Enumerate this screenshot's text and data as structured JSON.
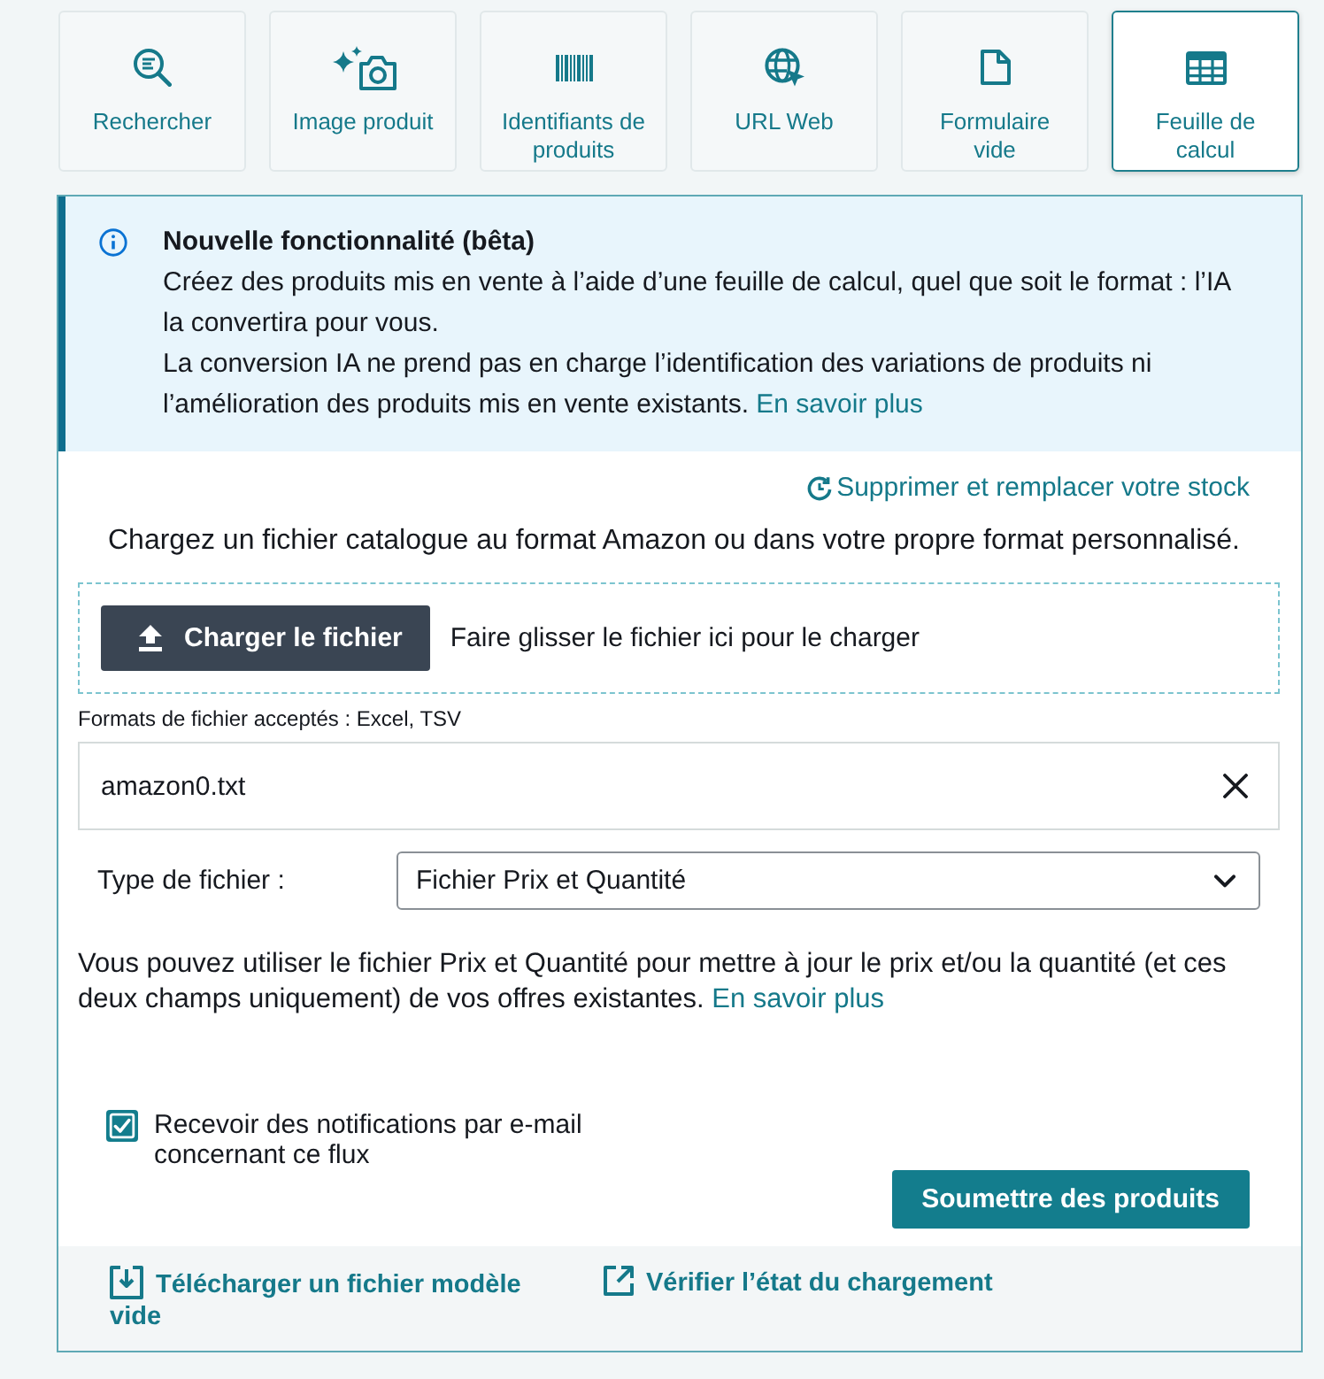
{
  "tabs": [
    {
      "label": "Rechercher",
      "selected": false
    },
    {
      "label": "Image produit",
      "selected": false
    },
    {
      "label": "Identifiants de produits",
      "selected": false
    },
    {
      "label": "URL Web",
      "selected": false
    },
    {
      "label": "Formulaire vide",
      "selected": false
    },
    {
      "label": "Feuille de calcul",
      "selected": true
    }
  ],
  "notice": {
    "title": "Nouvelle fonctionnalité (bêta)",
    "paragraphs": [
      {
        "text": "Créez des produits mis en vente à l’aide d’une feuille de calcul, quel que soit le format : l’IA la convertira pour vous."
      },
      {
        "text": "La conversion IA ne prend pas en charge l’identification des variations de produits ni l’amélioration des produits mis en vente existants.",
        "link": "En savoir plus"
      }
    ]
  },
  "replace_link": "Supprimer et remplacer votre stock",
  "intro": "Chargez un fichier catalogue au format Amazon ou dans votre propre format personnalisé.",
  "upload": {
    "button": "Charger le fichier",
    "drop_hint": "Faire glisser le fichier ici pour le charger",
    "formats": "Formats de fichier acceptés : Excel, TSV",
    "file_name": "amazon0.txt"
  },
  "file_type": {
    "label": "Type de fichier :",
    "value": "Fichier Prix et Quantité"
  },
  "help": {
    "text": "Vous pouvez utiliser le fichier Prix et Quantité pour mettre à jour le prix et/ou la quantité (et ces deux champs uniquement) de vos offres existantes.",
    "link": "En savoir plus"
  },
  "notify": {
    "label": "Recevoir des notifications par e-mail concernant ce flux",
    "checked": true
  },
  "submit": "Soumettre des produits",
  "footer_links": [
    "Télécharger un fichier modèle vide",
    "Vérifier l’état du chargement"
  ]
}
